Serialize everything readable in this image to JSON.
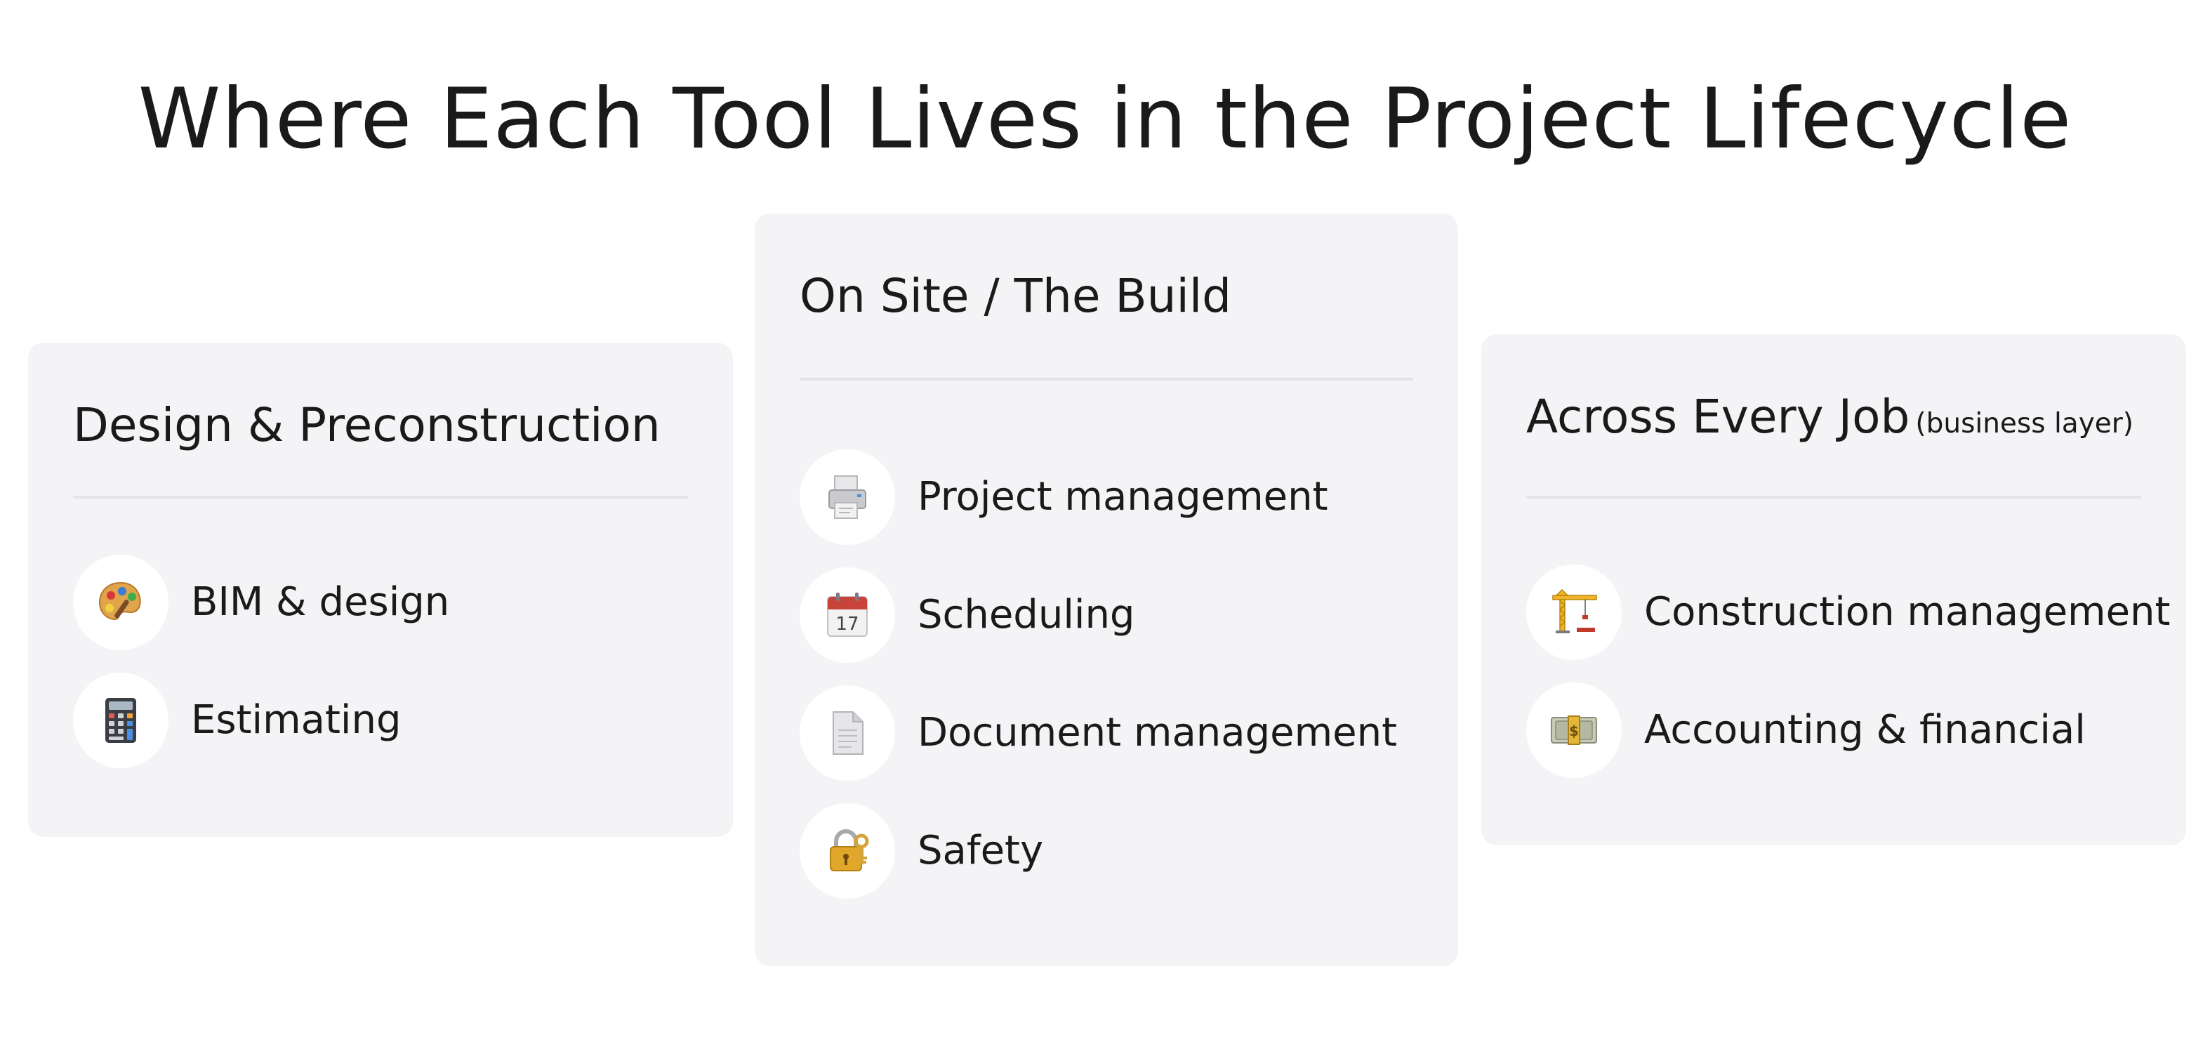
{
  "title": "Where Each Tool Lives in the Project Lifecycle",
  "columns": [
    {
      "title": "Design & Preconstruction",
      "subtitle": "",
      "items": [
        {
          "label": "BIM & design",
          "icon": "artist-palette-icon"
        },
        {
          "label": "Estimating",
          "icon": "calculator-icon"
        }
      ]
    },
    {
      "title": "On Site / The Build",
      "subtitle": "",
      "items": [
        {
          "label": "Project management",
          "icon": "printer-icon"
        },
        {
          "label": "Scheduling",
          "icon": "calendar-icon"
        },
        {
          "label": "Document management",
          "icon": "document-icon"
        },
        {
          "label": "Safety",
          "icon": "lock-with-key-icon"
        }
      ]
    },
    {
      "title": "Across Every Job",
      "subtitle": "(business layer)",
      "items": [
        {
          "label": "Construction management",
          "icon": "construction-crane-icon"
        },
        {
          "label": "Accounting & financial",
          "icon": "money-bundle-icon"
        }
      ]
    }
  ],
  "colors": {
    "card_background": "#f4f4f6",
    "text": "#1a1a1a",
    "divider": "#e4e4e8",
    "icon_background": "#ffffff"
  }
}
